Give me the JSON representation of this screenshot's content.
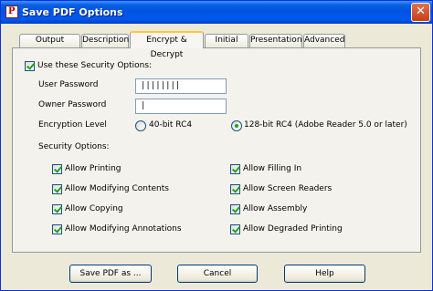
{
  "window": {
    "title": "Save PDF Options",
    "app_icon": "pdf-icon",
    "close_icon": "close-icon"
  },
  "tabs": [
    {
      "label": "Output Options",
      "active": false
    },
    {
      "label": "Description",
      "active": false
    },
    {
      "label": "Encrypt & Decrypt",
      "active": true
    },
    {
      "label": "Initial View",
      "active": false
    },
    {
      "label": "Presentation",
      "active": false
    },
    {
      "label": "Advanced",
      "active": false
    }
  ],
  "security": {
    "use_options_label": "Use these Security Options:",
    "use_options_checked": true,
    "user_password_label": "User Password",
    "user_password_value": "||||||||",
    "owner_password_label": "Owner Password",
    "owner_password_value": "|",
    "encryption_label": "Encryption Level",
    "encryption_options": [
      {
        "label": "40-bit RC4",
        "selected": false
      },
      {
        "label": "128-bit RC4 (Adobe Reader 5.0 or later)",
        "selected": true
      }
    ],
    "options_heading": "Security Options:",
    "permissions": [
      {
        "label": "Allow Printing",
        "checked": true
      },
      {
        "label": "Allow Filling In",
        "checked": true
      },
      {
        "label": "Allow Modifying Contents",
        "checked": true
      },
      {
        "label": "Allow Screen Readers",
        "checked": true
      },
      {
        "label": "Allow Copying",
        "checked": true
      },
      {
        "label": "Allow Assembly",
        "checked": true
      },
      {
        "label": "Allow Modifying Annotations",
        "checked": true
      },
      {
        "label": "Allow Degraded Printing",
        "checked": true
      }
    ]
  },
  "buttons": {
    "save": "Save PDF as ...",
    "cancel": "Cancel",
    "help": "Help"
  }
}
